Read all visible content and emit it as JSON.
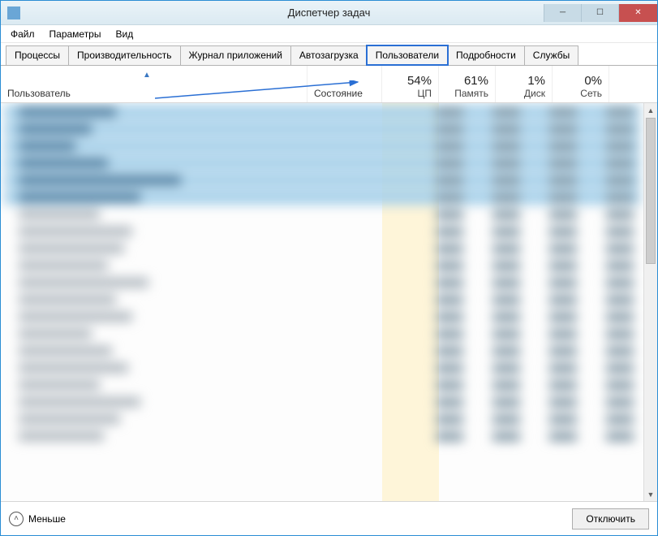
{
  "window": {
    "title": "Диспетчер задач"
  },
  "menu": {
    "file": "Файл",
    "options": "Параметры",
    "view": "Вид"
  },
  "tabs": {
    "processes": "Процессы",
    "performance": "Производительность",
    "apphistory": "Журнал приложений",
    "startup": "Автозагрузка",
    "users": "Пользователи",
    "details": "Подробности",
    "services": "Службы"
  },
  "columns": {
    "user": "Пользователь",
    "state": "Состояние",
    "cpu_pct": "54%",
    "cpu_label": "ЦП",
    "mem_pct": "61%",
    "mem_label": "Память",
    "disk_pct": "1%",
    "disk_label": "Диск",
    "net_pct": "0%",
    "net_label": "Сеть"
  },
  "footer": {
    "fewer": "Меньше",
    "disconnect": "Отключить"
  }
}
